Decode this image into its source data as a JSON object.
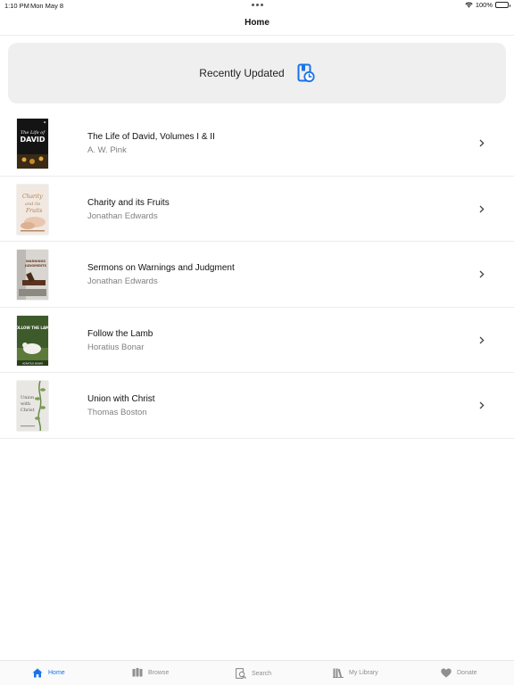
{
  "status_bar": {
    "time": "1:10 PM",
    "date": "Mon May 8",
    "battery": "100%"
  },
  "nav": {
    "title": "Home"
  },
  "recent": {
    "label": "Recently Updated",
    "icon": "book-clock-icon"
  },
  "books": [
    {
      "title": "The Life of David, Volumes I & II",
      "author": "A. W. Pink",
      "cover_title": "DAVID"
    },
    {
      "title": "Charity and its Fruits",
      "author": "Jonathan Edwards",
      "cover_title": "Charity and its Fruits"
    },
    {
      "title": "Sermons on Warnings and Judgment",
      "author": "Jonathan Edwards",
      "cover_title": "WARNINGS JUDGMENTS"
    },
    {
      "title": "Follow the Lamb",
      "author": "Horatius Bonar",
      "cover_title": "FOLLOW THE LAMB"
    },
    {
      "title": "Union with Christ",
      "author": "Thomas Boston",
      "cover_title": "Union with Christ"
    }
  ],
  "tabs": [
    {
      "label": "Home",
      "icon": "house-icon",
      "active": true
    },
    {
      "label": "Browse",
      "icon": "books-icon",
      "active": false
    },
    {
      "label": "Search",
      "icon": "search-book-icon",
      "active": false
    },
    {
      "label": "My Library",
      "icon": "library-icon",
      "active": false
    },
    {
      "label": "Donate",
      "icon": "heart-icon",
      "active": false
    }
  ],
  "colors": {
    "accent": "#1a73e8",
    "card_bg": "#efefef",
    "muted_text": "#808080"
  }
}
